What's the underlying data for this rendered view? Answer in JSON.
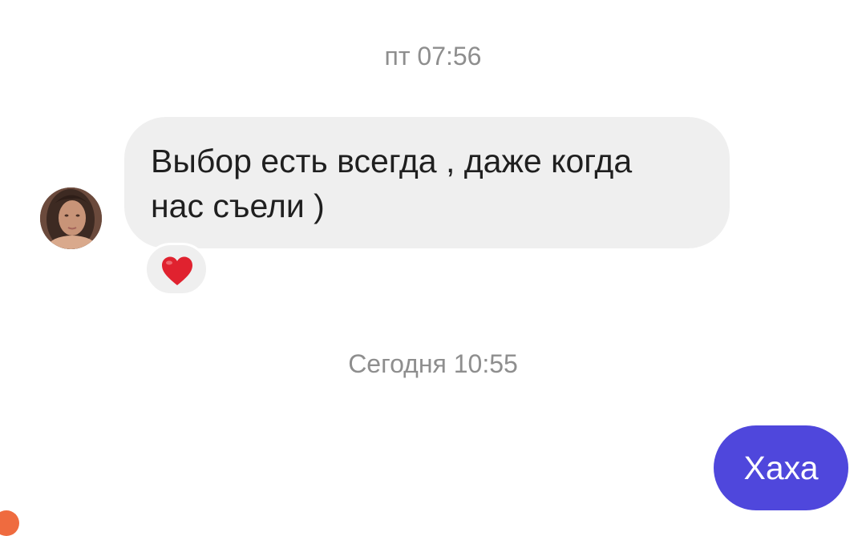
{
  "timestamps": {
    "first": "пт 07:56",
    "second": "Сегодня 10:55"
  },
  "incoming_message": {
    "text": "Выбор есть всегда , даже когда\nнас съели )",
    "reaction": "heart-icon"
  },
  "outgoing_message": {
    "text": "Хаха"
  },
  "colors": {
    "incoming_bubble": "#efefef",
    "outgoing_bubble": "#4f47dc",
    "timestamp_text": "#8e8e8e",
    "reaction_heart": "#e0222f"
  }
}
